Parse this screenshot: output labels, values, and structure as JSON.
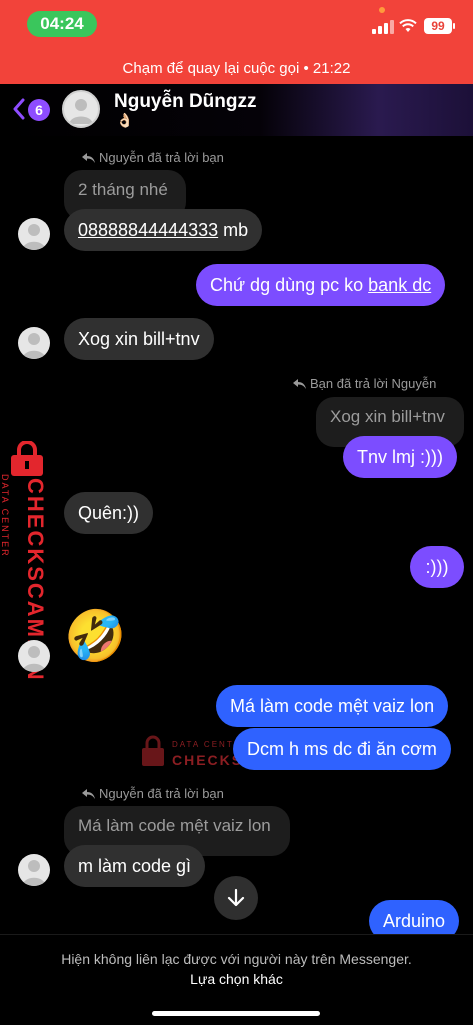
{
  "status": {
    "time": "04:24",
    "battery": "99"
  },
  "call_banner": {
    "text": "Chạm để quay lại cuộc gọi • 21:22"
  },
  "header": {
    "back_count": "6",
    "name": "Nguyễn Dũngzz",
    "emoji": "👌🏻"
  },
  "messages": {
    "reply_label_1": "Nguyễn đã trả lời bạn",
    "quote_1": "2 tháng nhé",
    "msg_1": "08888844444333",
    "msg_1_suffix": " mb",
    "msg_2_prefix": "Chứ dg dùng pc ko ",
    "msg_2_link": "bank dc",
    "msg_3": "Xog xin bill+tnv",
    "reply_label_2": "Bạn đã trả lời Nguyễn",
    "quote_2": "Xog xin bill+tnv",
    "msg_4": "Tnv lmj :)))",
    "msg_5": "Quên:))",
    "msg_6": ":)))",
    "msg_7": "🤣",
    "msg_8": "Má làm code mệt vaiz lon",
    "msg_9": "Dcm h ms dc đi ăn cơm",
    "reply_label_3": "Nguyễn đã trả lời bạn",
    "quote_3": "Má làm code mệt vaiz lon",
    "msg_10": "m làm code gì",
    "msg_11": "Arduino"
  },
  "watermark": {
    "brand": "CHECKSCAM.VN",
    "sub": "DATA CENTER"
  },
  "footer": {
    "notice": "Hiện không liên lạc được với người này trên Messenger.",
    "option": "Lựa chọn khác"
  },
  "colors": {
    "call_banner": "#f2433a",
    "outgoing_purple": "#7c4dff",
    "outgoing_blue": "#2f62ff",
    "incoming": "#303030"
  }
}
